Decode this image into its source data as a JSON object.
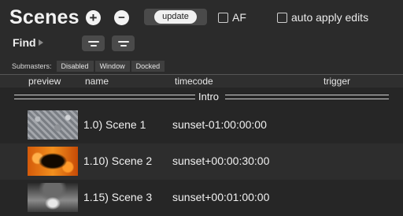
{
  "toolbar": {
    "title": "Scenes",
    "add_icon": "plus-circle-icon",
    "remove_icon": "minus-circle-icon",
    "update_label": "update",
    "af_label": "AF",
    "auto_apply_label": "auto apply edits",
    "af_checked": false,
    "auto_apply_checked": false
  },
  "find": {
    "label": "Find",
    "disclosure_icon": "triangle-right-icon",
    "filter_icons": [
      "filter-lines-icon",
      "filter-lines-icon"
    ]
  },
  "submasters": {
    "label": "Submasters:",
    "options": [
      "Disabled",
      "Window",
      "Docked"
    ]
  },
  "table": {
    "headers": [
      "preview",
      "name",
      "timecode",
      "trigger"
    ],
    "group_label": "Intro",
    "rows": [
      {
        "name": "1.0) Scene 1",
        "timecode": "sunset-01:00:00:00",
        "trigger": ""
      },
      {
        "name": "1.10) Scene 2",
        "timecode": "sunset+00:00:30:00",
        "trigger": ""
      },
      {
        "name": "1.15) Scene 3",
        "timecode": "sunset+00:01:00:00",
        "trigger": ""
      }
    ]
  },
  "colors": {
    "background": "#262626",
    "panel": "#2b2b2b",
    "button": "#4a4a4a",
    "text": "#f0f0f0"
  }
}
